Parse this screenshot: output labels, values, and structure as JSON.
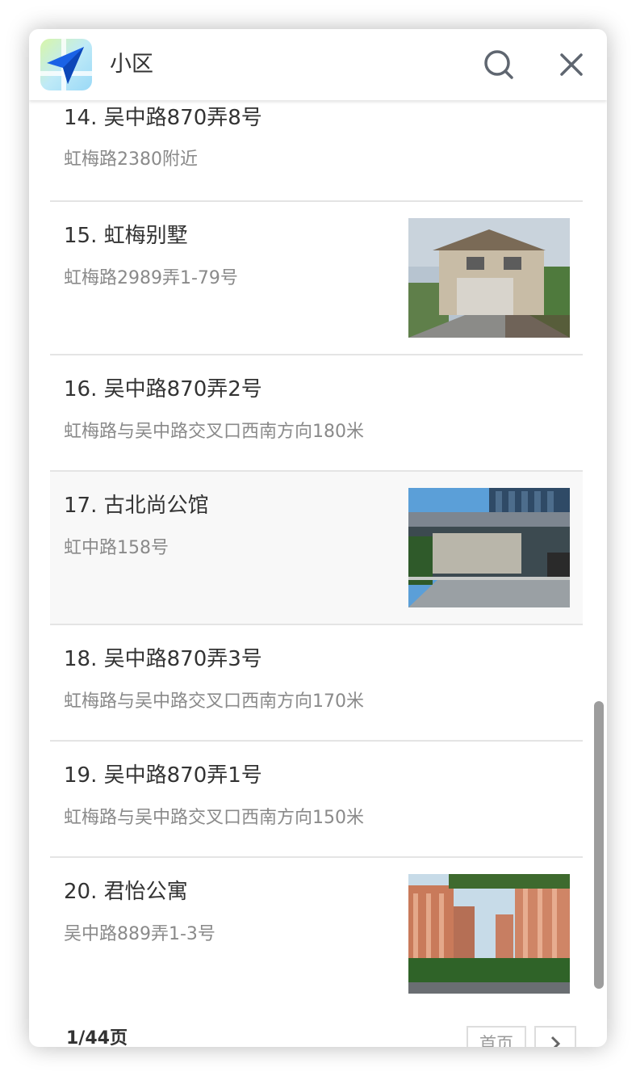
{
  "header": {
    "title": "小区",
    "logo_icon": "paper-plane-map-icon",
    "search_icon": "search-icon",
    "close_icon": "close-icon",
    "accent": "#1a73e8"
  },
  "items": [
    {
      "name": "14. 吴中路870弄8号",
      "address": "虹梅路2380附近",
      "has_photo": false
    },
    {
      "name": "15. 虹梅别墅",
      "address": "虹梅路2989弄1-79号",
      "has_photo": true
    },
    {
      "name": "16. 吴中路870弄2号",
      "address": "虹梅路与吴中路交叉口西南方向180米",
      "has_photo": false
    },
    {
      "name": "17. 古北尚公馆",
      "address": "虹中路158号",
      "has_photo": true
    },
    {
      "name": "18. 吴中路870弄3号",
      "address": "虹梅路与吴中路交叉口西南方向170米",
      "has_photo": false
    },
    {
      "name": "19. 吴中路870弄1号",
      "address": "虹梅路与吴中路交叉口西南方向150米",
      "has_photo": false
    },
    {
      "name": "20. 君怡公寓",
      "address": "吴中路889弄1-3号",
      "has_photo": true
    }
  ],
  "pagination": {
    "page_info": "1/44页",
    "first_label": "首页",
    "next_icon": "chevron-right-icon"
  }
}
